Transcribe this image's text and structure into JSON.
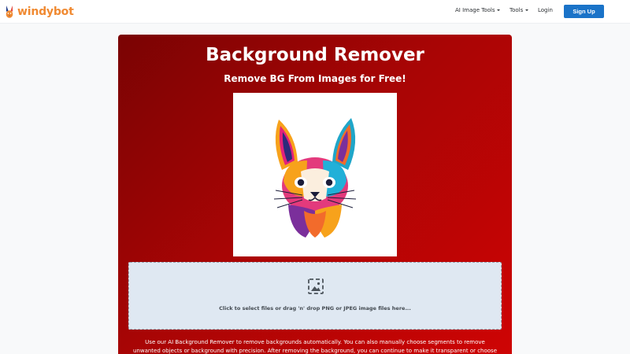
{
  "nav": {
    "brand": "windybot",
    "items": [
      {
        "label": "AI Image Tools",
        "dropdown": true,
        "icon": "chevron-down-icon"
      },
      {
        "label": "Tools",
        "dropdown": true,
        "icon": "chevron-down-icon"
      },
      {
        "label": "Login",
        "dropdown": false
      }
    ],
    "signup": "Sign Up"
  },
  "hero": {
    "title": "Background Remover",
    "subtitle": "Remove BG From Images for Free!",
    "preview_icon": "rabbit-illustration"
  },
  "dropzone": {
    "icon": "image-icon",
    "text": "Click to select files or drag 'n' drop PNG or JPEG image files here..."
  },
  "description": "Use our AI Background Remover to remove backgrounds automatically. You can also manually choose segments to remove unwanted objects or background with precision. After removing the background, you can continue to make it transparent or choose from many",
  "colors": {
    "brand": "#f08a32",
    "accent": "#1a73c8",
    "hero_dark": "#7a0303",
    "hero_light": "#cf0404",
    "dropzone_bg": "#dfe8f2"
  }
}
